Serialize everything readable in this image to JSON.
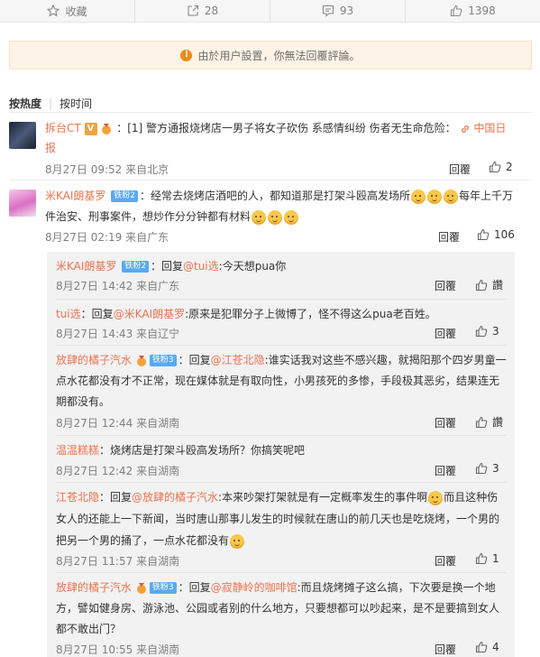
{
  "actionbar": {
    "favorite": "收藏",
    "share": "28",
    "comment": "93",
    "like": "1398"
  },
  "notice": {
    "text": "由於用户設置，你無法回覆評論。"
  },
  "sort": {
    "hot": "按热度",
    "time": "按时间"
  },
  "comments": [
    {
      "user": "拆台CT",
      "prefix": "：[1] ",
      "text1": "警方通报烧烤店一男子将女子砍伤 系感情纠纷 伤者无生命危险：",
      "link": "中国日",
      "text2": "报",
      "time": "8月27日 09:52 来自北京",
      "reply": "回覆",
      "likes": "2"
    },
    {
      "user": "米KAI朗基罗",
      "badge": "铁粉2",
      "text1": "：经常去烧烤店酒吧的人，都知道那是打架斗殴高发场所",
      "text1b": "每年上千万",
      "text2": "件治安、刑事案件，想炒作分分钟都有材料",
      "time": "8月27日 02:19 来自广东",
      "reply": "回覆",
      "likes": "106",
      "replies": [
        {
          "user": "米KAI朗基罗",
          "badge": "铁粉2",
          "text1": "：回复",
          "mention": "@tui选",
          "text2": ":今天想pua你",
          "time": "8月27日 14:42 来自广东",
          "reply": "回覆",
          "likes": "讚"
        },
        {
          "user": "tui选",
          "text1": "：回复",
          "mention": "@米KAI朗基罗",
          "text2": ":原来是犯罪分子上微博了，怪不得这么pua老百姓。",
          "time": "8月27日 14:43 来自辽宁",
          "reply": "回覆",
          "likes": "3"
        },
        {
          "user": "放肆的橘子汽水",
          "badge": "铁粉3",
          "text1": "：回复",
          "mention": "@江苍北隐",
          "text2": ":谁实话我对这些不感兴趣，就揭阳那个四岁男童一",
          "text3": "点水花都没有才不正常，现在媒体就是有取向性，小男孩死的多惨，手段极其恶劣，结果连无",
          "text4": "期都没有。",
          "time": "8月27日 12:44 来自湖南",
          "reply": "回覆",
          "likes": "讚"
        },
        {
          "user": "温温糕糕",
          "text1": "：烧烤店是打架斗殴高发场所？你搞笑呢吧",
          "time": "8月27日 12:42 来自湖南",
          "reply": "回覆",
          "likes": "3"
        },
        {
          "user": "江苍北隐",
          "text1": "：回复",
          "mention": "@放肆的橘子汽水",
          "text2": ":本来吵架打架就是有一定概率发生的事件啊",
          "text2b": "而且这种伤",
          "text3": "女人的还能上一下新闻，当时唐山那事儿发生的时候就在唐山的前几天也是吃烧烤，一个男的",
          "text4": "把另一个男的捅了，一点水花都没有",
          "time": "8月27日 11:57 来自湖南",
          "reply": "回覆",
          "likes": "1"
        },
        {
          "user": "放肆的橘子汽水",
          "badge": "铁粉3",
          "text1": "：回复",
          "mention": "@寂静岭的咖啡馆",
          "text2": ":而且烧烤摊子这么搞，下次要是换一个地",
          "text3": "方，譬如健身房、游泳池、公园或者别的什么地方，只要想都可以吵起来，是不是要搞到女人",
          "text4": "都不敢出门？",
          "time": "8月27日 10:55 来自湖南",
          "reply": "回覆",
          "likes": "4"
        }
      ]
    }
  ],
  "colors": {
    "username": "#eb7350",
    "meta": "#808080",
    "notice_bg": "#fdf3e6",
    "reply_bg": "#f2f2f2"
  }
}
